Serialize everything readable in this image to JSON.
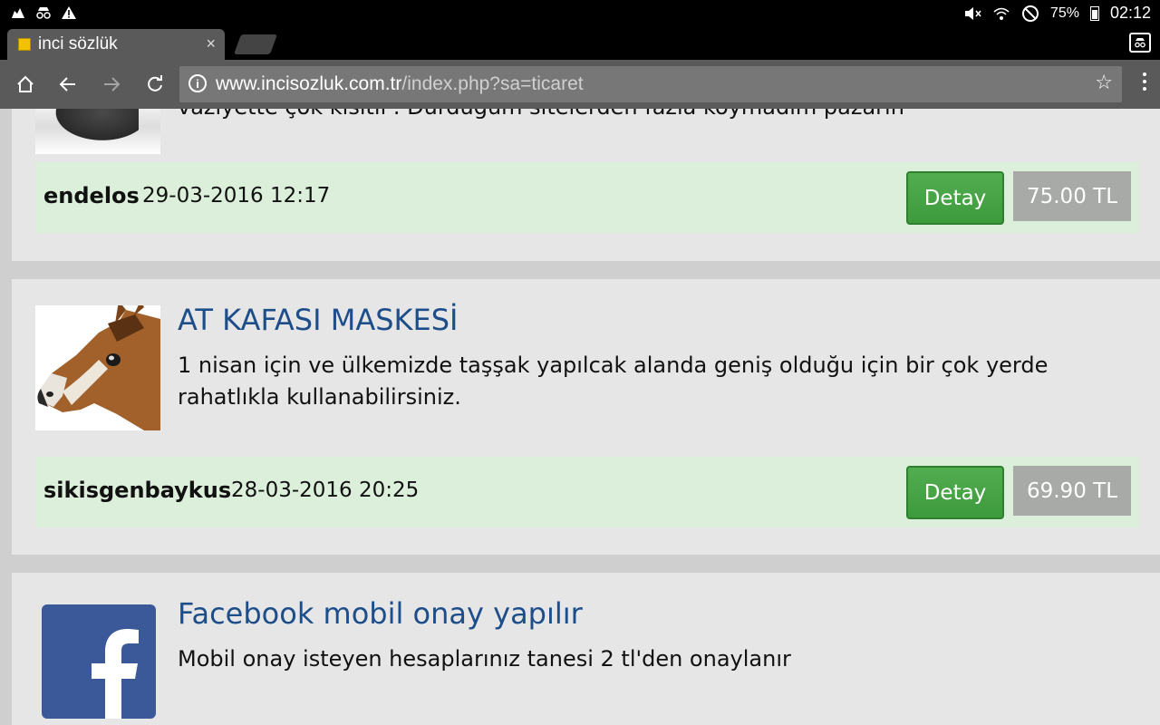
{
  "status_bar": {
    "battery": "75%",
    "time": "02:12"
  },
  "tab": {
    "title": "inci sözlük",
    "close": "×"
  },
  "omnibox": {
    "host": "www.incisozluk.com.tr",
    "path": "/index.php?sa=ticaret"
  },
  "listings": [
    {
      "desc_cut": "vaziyette çok kısıtlı . Durdugum sitelerden fazla koymadım pazarin",
      "user": "endelos",
      "date": "29-03-2016 12:17",
      "button": "Detay",
      "price": "75.00 TL"
    },
    {
      "title": "AT KAFASI MASKESİ",
      "desc": "1 nisan için ve ülkemizde taşşak yapılcak alanda geniş olduğu için bir çok yerde rahatlıkla kullanabilirsiniz.",
      "user": "sikisgenbaykus",
      "date": "28-03-2016 20:25",
      "button": "Detay",
      "price": "69.90 TL"
    },
    {
      "title": "Facebook mobil onay yapılır",
      "desc": "Mobil onay isteyen hesaplarınız tanesi 2 tl'den onaylanır"
    }
  ]
}
